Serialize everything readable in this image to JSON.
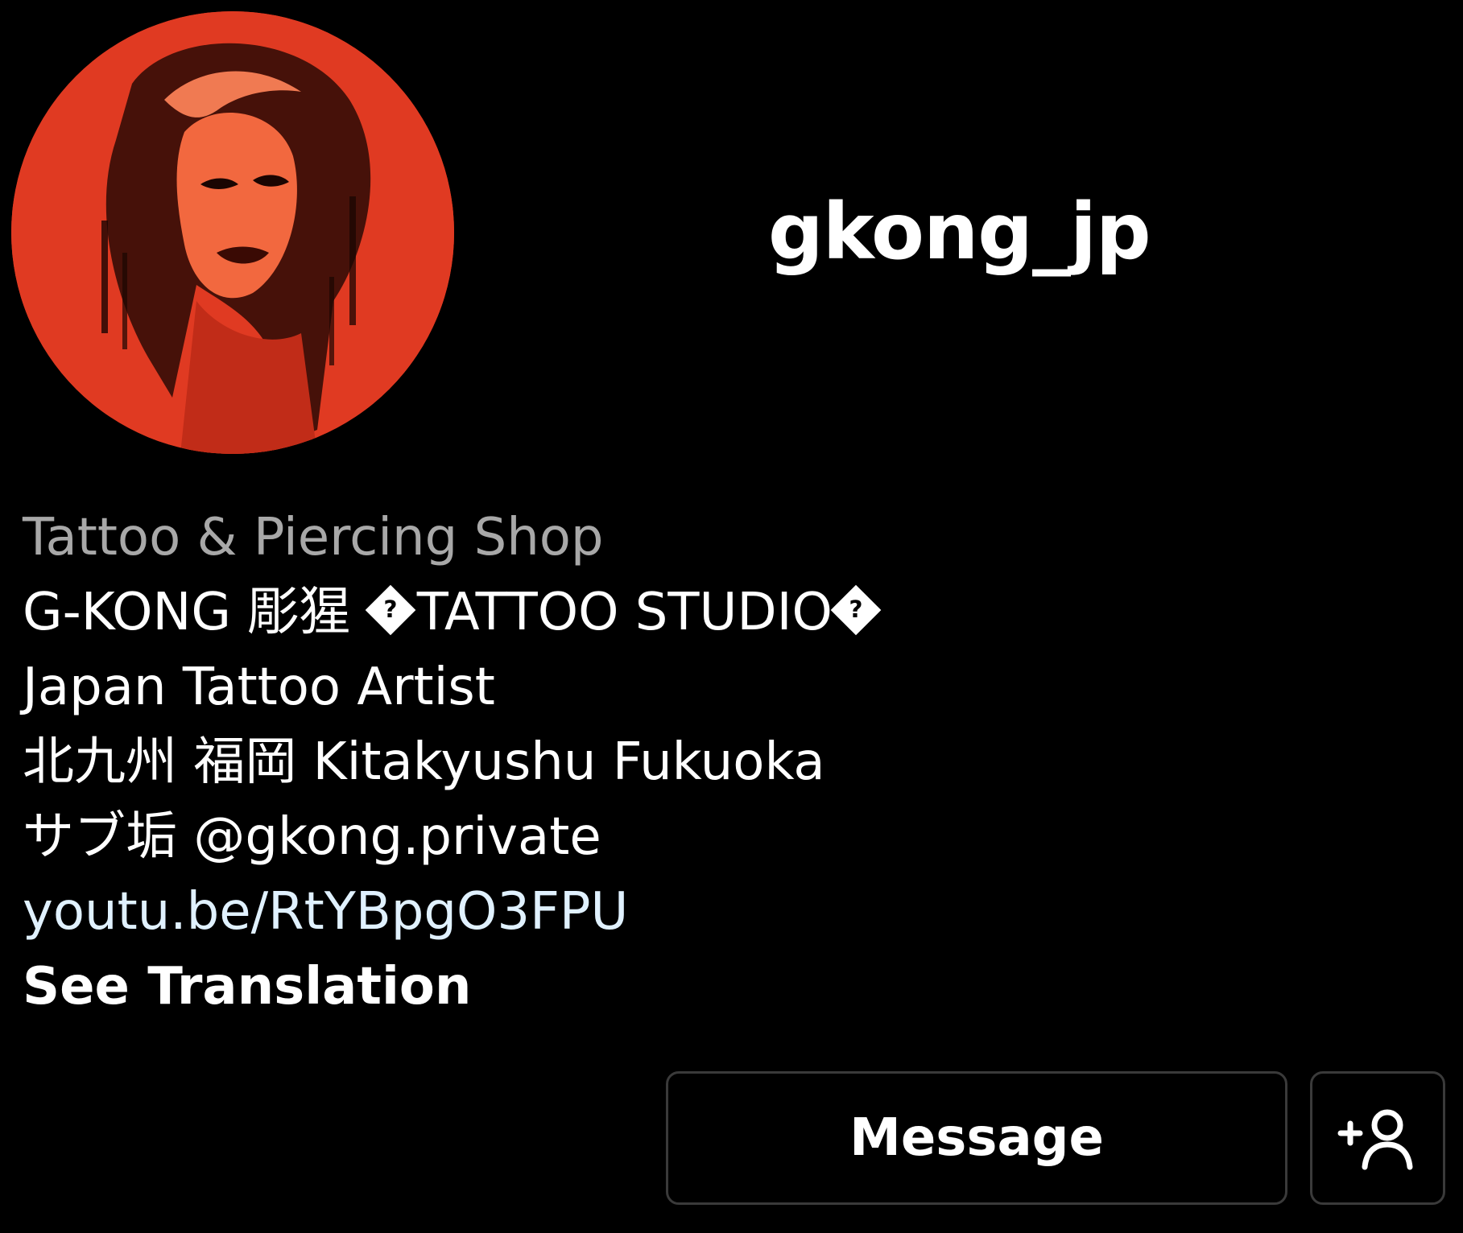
{
  "profile": {
    "username": "gkong_jp",
    "avatar_icon": "profile-avatar",
    "avatar_color": "#e03a22"
  },
  "bio": {
    "category": "Tattoo & Piercing Shop",
    "line1_prefix": "G-KONG 彫猩 ",
    "line1_main": "TATTOO STUDIO",
    "unknown_glyph": "?",
    "line2": "Japan Tattoo Artist",
    "line3": "北九州 福岡 Kitakyushu Fukuoka",
    "line4": "サブ垢 @gkong.private",
    "link": "youtu.be/RtYBpgO3FPU",
    "see_translation": "See Translation",
    "colors": {
      "category": "#a8a8a8",
      "link": "#e0f1ff"
    }
  },
  "actions": {
    "message_label": "Message",
    "add_friend_icon": "add-person-icon"
  }
}
